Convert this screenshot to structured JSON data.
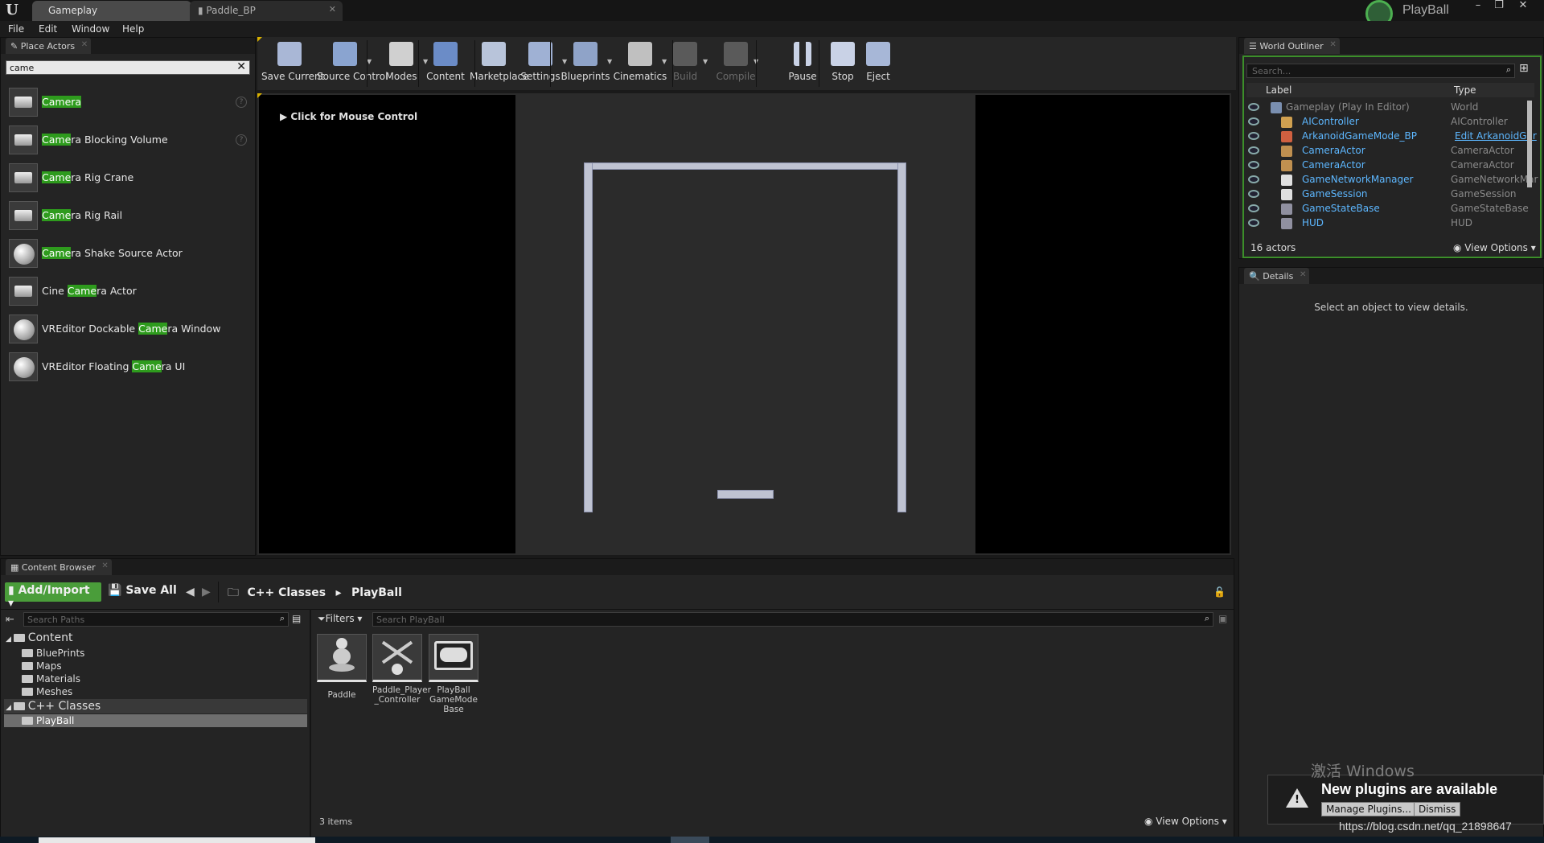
{
  "titlebar": {
    "tabs": [
      {
        "label": "Gameplay"
      },
      {
        "label": "Paddle_BP"
      }
    ],
    "project_name": "PlayBall"
  },
  "menubar": {
    "items": [
      "File",
      "Edit",
      "Window",
      "Help"
    ]
  },
  "place_actors": {
    "tab_label": "Place Actors",
    "search_value": "came",
    "items": [
      {
        "pre": "",
        "hl": "Camera",
        "post": "",
        "icon": "camera-icon"
      },
      {
        "pre": "",
        "hl": "Came",
        "post": "ra Blocking Volume",
        "icon": "volume-icon"
      },
      {
        "pre": "",
        "hl": "Came",
        "post": "ra Rig Crane",
        "icon": "crane-icon"
      },
      {
        "pre": "",
        "hl": "Came",
        "post": "ra Rig Rail",
        "icon": "rail-icon"
      },
      {
        "pre": "",
        "hl": "Came",
        "post": "ra Shake Source Actor",
        "icon": "sphere-icon"
      },
      {
        "pre": "Cine ",
        "hl": "Came",
        "post": "ra Actor",
        "icon": "cine-camera-icon"
      },
      {
        "pre": "VREditor Dockable ",
        "hl": "Came",
        "post": "ra Window",
        "icon": "sphere-icon"
      },
      {
        "pre": "VREditor Floating ",
        "hl": "Came",
        "post": "ra UI",
        "icon": "sphere-icon"
      }
    ]
  },
  "toolbar": {
    "buttons": [
      {
        "label": "Save Current",
        "icon": "save-icon"
      },
      {
        "label": "Source Control",
        "icon": "source-control-icon"
      },
      {
        "label": "Modes",
        "icon": "modes-icon"
      },
      {
        "label": "Content",
        "icon": "content-icon"
      },
      {
        "label": "Marketplace",
        "icon": "marketplace-icon"
      },
      {
        "label": "Settings",
        "icon": "settings-icon"
      },
      {
        "label": "Blueprints",
        "icon": "blueprints-icon"
      },
      {
        "label": "Cinematics",
        "icon": "cinematics-icon"
      },
      {
        "label": "Build",
        "icon": "build-icon"
      },
      {
        "label": "Compile",
        "icon": "compile-icon"
      },
      {
        "label": "Pause",
        "icon": "pause-icon"
      },
      {
        "label": "Stop",
        "icon": "stop-icon"
      },
      {
        "label": "Eject",
        "icon": "eject-icon"
      }
    ]
  },
  "viewport": {
    "hint": "Click for Mouse Control"
  },
  "outliner": {
    "tab_label": "World Outliner",
    "search_placeholder": "Search...",
    "col_label": "Label",
    "col_type": "Type",
    "rows": [
      {
        "label": "Gameplay (Play In Editor)",
        "type": "World"
      },
      {
        "label": "AIController",
        "type": "AIController"
      },
      {
        "label": "ArkanoidGameMode_BP",
        "type": "Edit ArkanoidGar"
      },
      {
        "label": "CameraActor",
        "type": "CameraActor"
      },
      {
        "label": "CameraActor",
        "type": "CameraActor"
      },
      {
        "label": "GameNetworkManager",
        "type": "GameNetworkMar"
      },
      {
        "label": "GameSession",
        "type": "GameSession"
      },
      {
        "label": "GameStateBase",
        "type": "GameStateBase"
      },
      {
        "label": "HUD",
        "type": "HUD"
      }
    ],
    "count": "16 actors",
    "view_options": "View Options"
  },
  "details": {
    "tab_label": "Details",
    "empty_text": "Select an object to view details."
  },
  "content_browser": {
    "tab_label": "Content Browser",
    "add_import": "Add/Import",
    "save_all": "Save All",
    "breadcrumb": [
      "C++ Classes",
      "PlayBall"
    ],
    "search_paths_placeholder": "Search Paths",
    "filters": "Filters",
    "search_placeholder": "Search PlayBall",
    "tree": {
      "content": "Content",
      "content_children": [
        "BluePrints",
        "Maps",
        "Materials",
        "Meshes"
      ],
      "cpp": "C++ Classes",
      "cpp_children": [
        "PlayBall"
      ]
    },
    "assets": [
      {
        "name": "Paddle",
        "icon": "pawn-icon"
      },
      {
        "name": "Paddle_Player\n_Controller",
        "icon": "controller-icon"
      },
      {
        "name": "PlayBall\nGameMode\nBase",
        "icon": "gamepad-icon"
      }
    ],
    "item_count": "3 items",
    "view_options": "View Options"
  },
  "toast": {
    "message": "New plugins are available",
    "manage_btn": "Manage Plugins...",
    "dismiss_btn": "Dismiss"
  },
  "watermark": {
    "windows": "激活 Windows",
    "url": "https://blog.csdn.net/qq_21898647"
  }
}
